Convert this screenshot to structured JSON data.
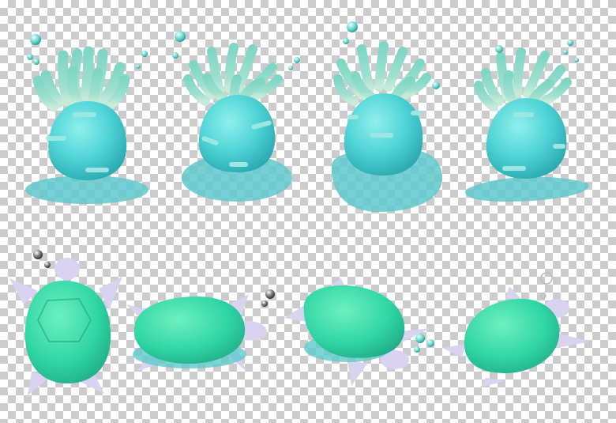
{
  "image": {
    "background": "transparency-checkerboard",
    "subjects": [
      "sea-anemone",
      "sea-turtle"
    ],
    "colors": {
      "anemone_body": "#4fd4d6",
      "anemone_tentacle": "#7fd6c4",
      "turtle_shell": "#2fd6a4",
      "turtle_skin": "#d9d2f0",
      "checker_light": "#ffffff",
      "checker_dark": "#cccccc"
    }
  }
}
